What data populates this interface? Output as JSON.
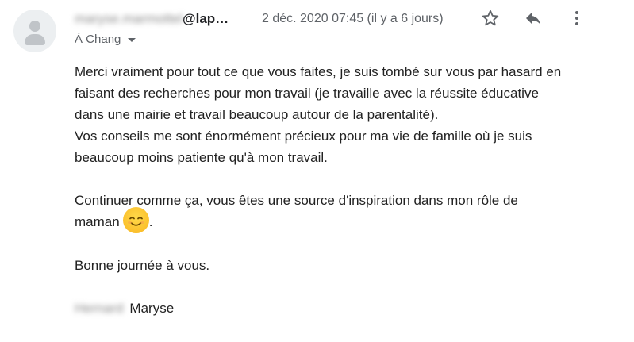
{
  "sender": {
    "name_blurred": "maryse.marmottel",
    "domain_visible": "@lap…"
  },
  "date": "2 déc. 2020 07:45 (il y a 6 jours)",
  "recipient": "À Chang",
  "actions": {
    "star_icon": "star-outline-icon",
    "reply_icon": "reply-arrow-icon",
    "more_icon": "more-vert-icon"
  },
  "body": {
    "p1_l1": "Merci vraiment pour tout ce que vous faites, je suis tombé sur vous par hasard en",
    "p1_l2": "faisant des recherches pour mon travail (je travaille avec la réussite éducative",
    "p1_l3": "dans une mairie et travail beaucoup autour de la parentalité).",
    "p1_l4": "Vos conseils me sont énormément précieux pour ma vie de famille où je suis",
    "p1_l5": "beaucoup moins patiente qu'à mon travail.",
    "p2_l1": "Continuer comme ça, vous êtes une source d'inspiration dans mon rôle de",
    "p2_l2_text": "maman",
    "p2_l2_end": ".",
    "emoji": "smiling-face-icon",
    "p3": "Bonne journée à vous.",
    "signature_blurred": "Hernard",
    "signature_name": "Maryse"
  },
  "colors": {
    "text": "#222222",
    "muted": "#5f6368",
    "avatar_bg": "#eceff1",
    "emoji": "#fbc02d"
  }
}
